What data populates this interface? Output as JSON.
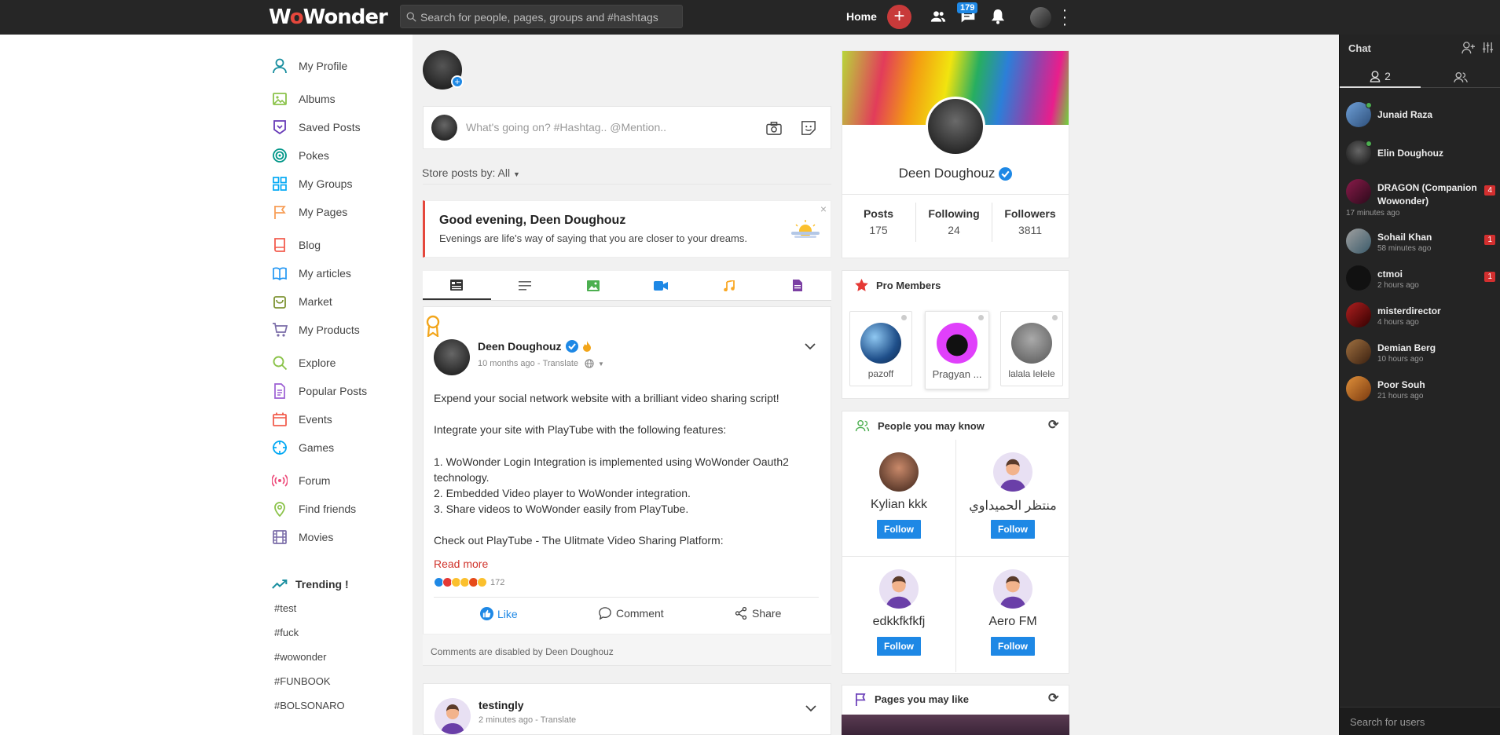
{
  "topbar": {
    "logo_pre": "W",
    "logo_acc": "o",
    "logo_post": "Wonder",
    "search_placeholder": "Search for people, pages, groups and #hashtags",
    "home_label": "Home",
    "add_label": "+",
    "messages_badge": "179"
  },
  "sidebar": {
    "items": [
      {
        "label": "My Profile",
        "icon": "user-icon",
        "color": "#1a8fa0"
      },
      {
        "label": "Albums",
        "icon": "image-icon",
        "color": "#8bc34a"
      },
      {
        "label": "Saved Posts",
        "icon": "bookmark-icon",
        "color": "#673ab7"
      },
      {
        "label": "Pokes",
        "icon": "target-icon",
        "color": "#009688"
      },
      {
        "label": "My Groups",
        "icon": "grid-icon",
        "color": "#03a9f4"
      },
      {
        "label": "My Pages",
        "icon": "flag-icon",
        "color": "#f79f58"
      },
      {
        "label": "Blog",
        "icon": "book-icon",
        "color": "#f35d4f"
      },
      {
        "label": "My articles",
        "icon": "open-book-icon",
        "color": "#2196f3"
      },
      {
        "label": "Market",
        "icon": "bag-icon",
        "color": "#7e9433"
      },
      {
        "label": "My Products",
        "icon": "cart-icon",
        "color": "#7a6ca8"
      },
      {
        "label": "Explore",
        "icon": "search-icon",
        "color": "#8bc34a"
      },
      {
        "label": "Popular Posts",
        "icon": "document-icon",
        "color": "#9c5fd3"
      },
      {
        "label": "Events",
        "icon": "calendar-icon",
        "color": "#f25e4e"
      },
      {
        "label": "Games",
        "icon": "crosshair-icon",
        "color": "#03a9f4"
      },
      {
        "label": "Forum",
        "icon": "broadcast-icon",
        "color": "#ed4b7a"
      },
      {
        "label": "Find friends",
        "icon": "pin-icon",
        "color": "#8bc34a"
      },
      {
        "label": "Movies",
        "icon": "film-icon",
        "color": "#7a6ca8"
      }
    ],
    "trending_title": "Trending !",
    "tags": [
      "#test",
      "#fuck",
      "#wowonder",
      "#FUNBOOK",
      "#BOLSONARO"
    ]
  },
  "composer": {
    "placeholder": "What's going on? #Hashtag.. @Mention.."
  },
  "sort": {
    "label": "Store posts by:",
    "value": "All"
  },
  "greeting": {
    "title": "Good evening, Deen Doughouz",
    "text": "Evenings are life's way of saying that you are closer to your dreams.",
    "close": "×"
  },
  "post": {
    "author": "Deen Doughouz",
    "time": "10 months ago",
    "translate": "Translate",
    "lines": [
      "Expend your social network website with a brilliant video sharing script!",
      "",
      "Integrate your site with PlayTube with the following features:",
      "",
      "1. WoWonder Login Integration is implemented using WoWonder Oauth2 technology.",
      "2. Embedded Video player to WoWonder integration.",
      "3. Share videos to WoWonder easily from PlayTube.",
      "",
      "Check out PlayTube - The Ulitmate Video Sharing Platform:"
    ],
    "read_more": "Read more",
    "reactions_count": "172",
    "like": "Like",
    "comment": "Comment",
    "share": "Share",
    "comments_disabled": "Comments are disabled by Deen Doughouz"
  },
  "post2": {
    "author": "testingly",
    "time": "2 minutes ago",
    "translate": "Translate"
  },
  "profile": {
    "name": "Deen Doughouz",
    "stats": [
      {
        "label": "Posts",
        "value": "175"
      },
      {
        "label": "Following",
        "value": "24"
      },
      {
        "label": "Followers",
        "value": "3811"
      }
    ]
  },
  "pro_members": {
    "title": "Pro Members",
    "members": [
      "pazoff",
      "Pragyan ...",
      "lalala lelele"
    ]
  },
  "people": {
    "title": "People you may know",
    "follow_label": "Follow",
    "list": [
      "Kylian kkk",
      "منتظر الحميداوي",
      "edkkfkfkfj",
      "Aero FM"
    ]
  },
  "pages": {
    "title": "Pages you may like"
  },
  "chat": {
    "title": "Chat",
    "online_count": "2",
    "search_placeholder": "Search for users",
    "users": [
      {
        "name": "Junaid Raza",
        "time": "",
        "count": "",
        "online": true
      },
      {
        "name": "Elin Doughouz",
        "time": "",
        "count": "",
        "online": true
      },
      {
        "name": "DRAGON (Companion Wowonder)",
        "time": "17 minutes ago",
        "count": "4",
        "online": false
      },
      {
        "name": "Sohail Khan",
        "time": "58 minutes ago",
        "count": "1",
        "online": false
      },
      {
        "name": "ctmoi",
        "time": "2 hours ago",
        "count": "1",
        "online": false
      },
      {
        "name": "misterdirector",
        "time": "4 hours ago",
        "count": "",
        "online": false
      },
      {
        "name": "Demian Berg",
        "time": "10 hours ago",
        "count": "",
        "online": false
      },
      {
        "name": "Poor Souh",
        "time": "21 hours ago",
        "count": "",
        "online": false
      }
    ]
  }
}
